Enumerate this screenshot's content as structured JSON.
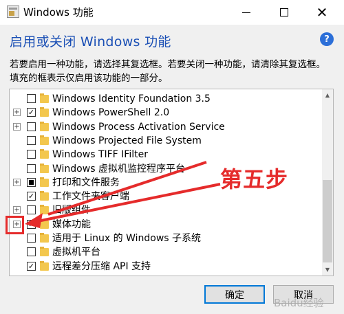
{
  "window": {
    "title": "Windows 功能",
    "controls": [
      "minimize-icon",
      "maximize-icon",
      "close-icon"
    ]
  },
  "heading": "启用或关闭 Windows 功能",
  "help_icon": "?",
  "description": "若要启用一种功能，请选择其复选框。若要关闭一种功能，请清除其复选框。填充的框表示仅启用该功能的一部分。",
  "features": [
    {
      "label": "Windows Identity Foundation 3.5",
      "expandable": false,
      "state": "unchecked"
    },
    {
      "label": "Windows PowerShell 2.0",
      "expandable": true,
      "state": "checked"
    },
    {
      "label": "Windows Process Activation Service",
      "expandable": true,
      "state": "unchecked"
    },
    {
      "label": "Windows Projected File System",
      "expandable": false,
      "state": "unchecked"
    },
    {
      "label": "Windows TIFF IFilter",
      "expandable": false,
      "state": "unchecked"
    },
    {
      "label": "Windows 虚拟机监控程序平台",
      "expandable": false,
      "state": "unchecked"
    },
    {
      "label": "打印和文件服务",
      "expandable": true,
      "state": "partial"
    },
    {
      "label": "工作文件夹客户端",
      "expandable": false,
      "state": "checked"
    },
    {
      "label": "旧版组件",
      "expandable": true,
      "state": "unchecked"
    },
    {
      "label": "媒体功能",
      "expandable": true,
      "state": "checked"
    },
    {
      "label": "适用于 Linux 的 Windows 子系统",
      "expandable": false,
      "state": "unchecked"
    },
    {
      "label": "虚拟机平台",
      "expandable": false,
      "state": "unchecked"
    },
    {
      "label": "远程差分压缩 API 支持",
      "expandable": false,
      "state": "checked"
    }
  ],
  "buttons": {
    "ok": "确定",
    "cancel": "取消"
  },
  "annotation": {
    "text": "第五步",
    "color": "#e52b2b"
  },
  "watermark": "Baidu经验",
  "colors": {
    "heading": "#1a4fb5",
    "default_button_border": "#0078d7",
    "folder": "#f3c74e"
  }
}
